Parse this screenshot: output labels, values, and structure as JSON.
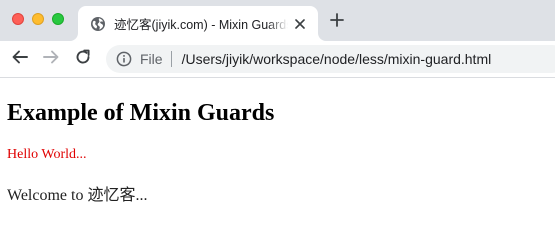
{
  "browser": {
    "tab": {
      "title": "迹忆客(jiyik.com) - Mixin Guards",
      "favicon": "globe-icon",
      "close_icon": "close-icon"
    },
    "new_tab_icon": "plus-icon",
    "nav": {
      "back_icon": "arrow-left-icon",
      "forward_icon": "arrow-right-icon",
      "reload_icon": "reload-icon"
    },
    "address": {
      "security_icon": "info-icon",
      "scheme_label": "File",
      "url": "/Users/jiyik/workspace/node/less/mixin-guard.html"
    }
  },
  "page": {
    "heading": "Example of Mixin Guards",
    "red_paragraph": "Hello World...",
    "welcome_paragraph": "Welcome to 迹忆客..."
  },
  "colors": {
    "tabstrip_bg": "#dee1e6",
    "omnibox_bg": "#f1f3f4",
    "red_text": "#e00000",
    "traffic_red": "#fe5f57",
    "traffic_yellow": "#febc2e",
    "traffic_green": "#28c840"
  }
}
